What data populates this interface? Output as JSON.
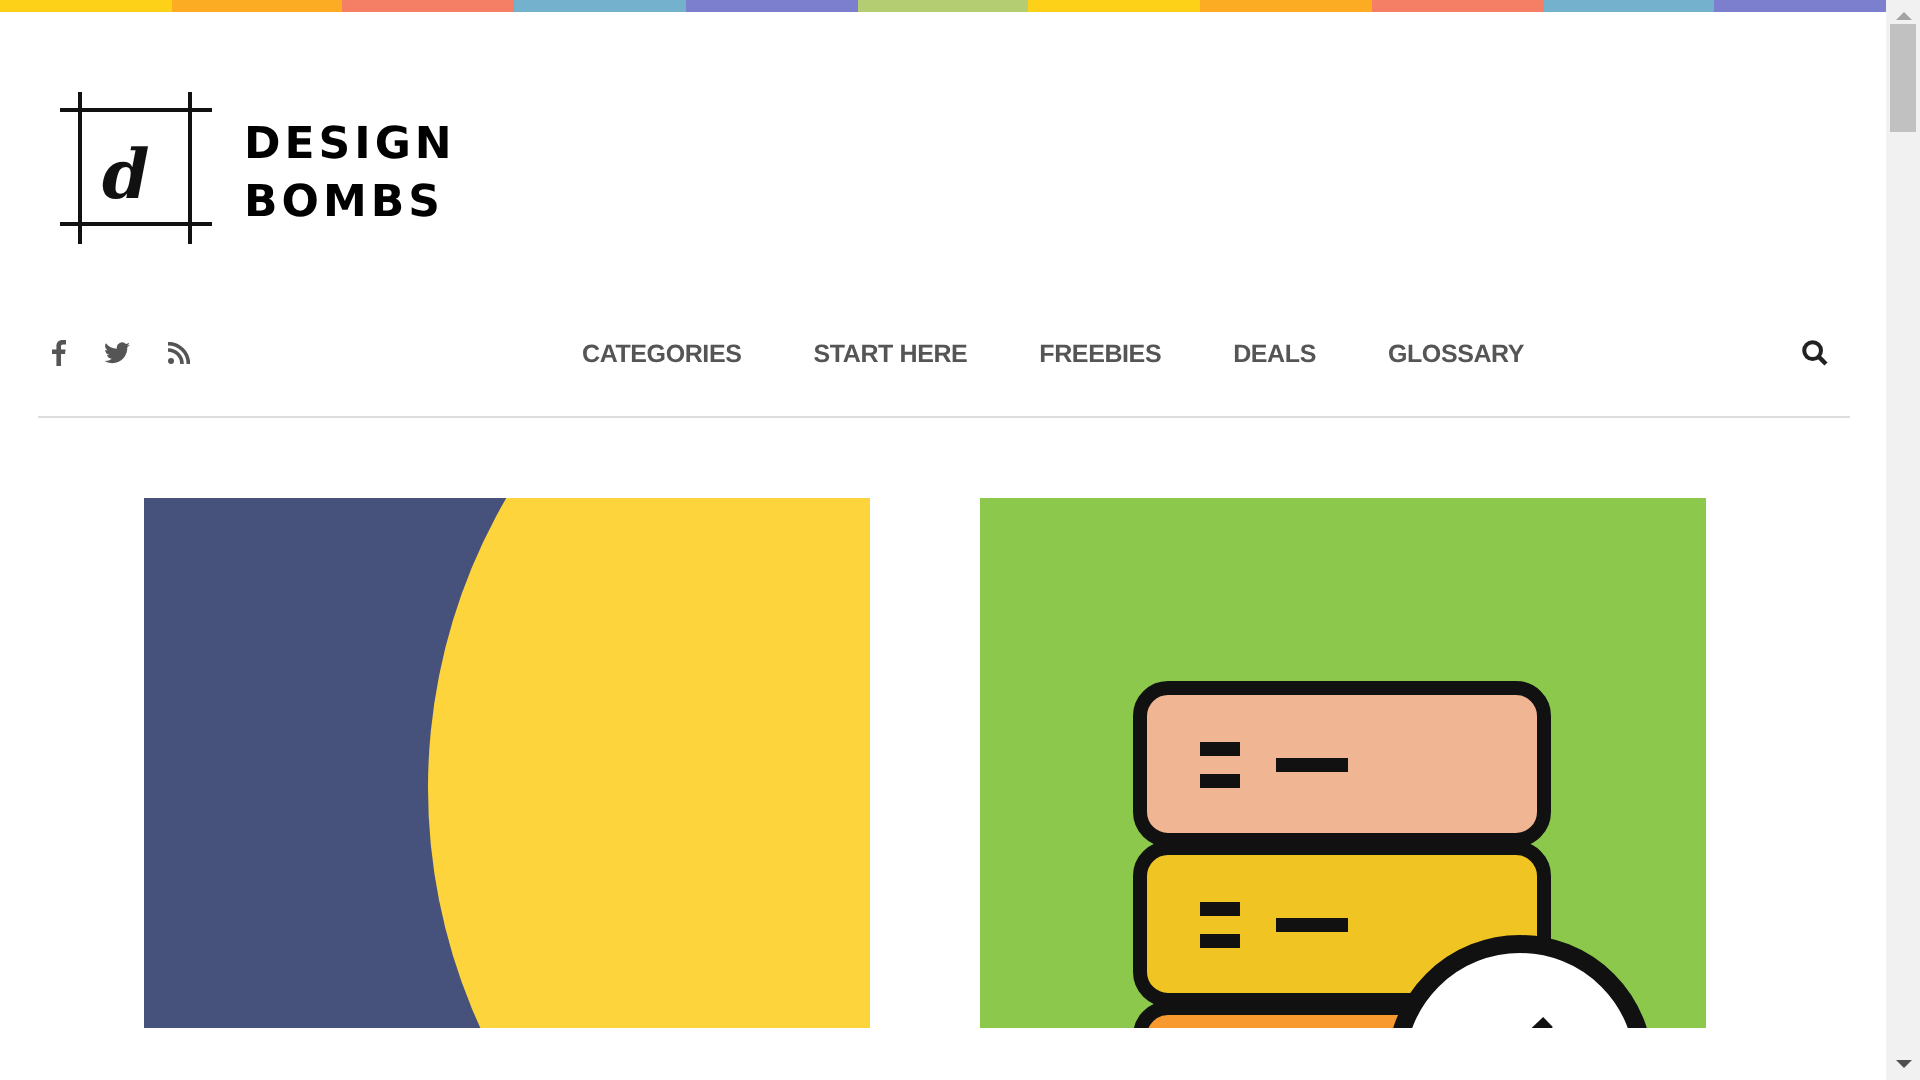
{
  "logo": {
    "letter": "d",
    "line_1": "DESIGN",
    "line_2": "BOMBS"
  },
  "social": [
    {
      "kind": "facebook"
    },
    {
      "kind": "twitter"
    },
    {
      "kind": "rss"
    }
  ],
  "nav": [
    {
      "label": "CATEGORIES"
    },
    {
      "label": "START HERE"
    },
    {
      "label": "FREEBIES"
    },
    {
      "label": "DEALS"
    },
    {
      "label": "GLOSSARY"
    }
  ]
}
